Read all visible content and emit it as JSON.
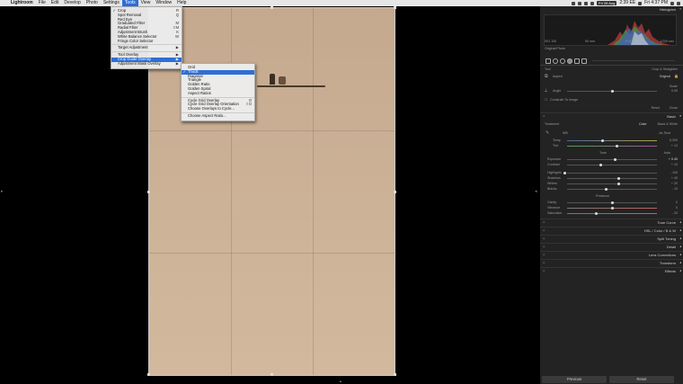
{
  "menubar": {
    "app_name": "Lightroom",
    "items": [
      "File",
      "Edit",
      "Develop",
      "Photo",
      "Settings",
      "Tools",
      "View",
      "Window",
      "Help"
    ],
    "active": "Tools",
    "battery": "Fri 26 Aug",
    "time_left": "2:39 EE",
    "clock": "Fri 4:37 PM"
  },
  "tools_menu": [
    {
      "label": "Crop",
      "key": "R",
      "checked": true
    },
    {
      "label": "Spot Removal",
      "key": "Q"
    },
    {
      "label": "Red Eye",
      "key": ""
    },
    {
      "label": "Graduated Filter",
      "key": "M"
    },
    {
      "label": "Radial Filter",
      "key": "⇧M"
    },
    {
      "label": "Adjustment Brush",
      "key": "K"
    },
    {
      "label": "White Balance Selector",
      "key": "W"
    },
    {
      "label": "Fringe Color Selector",
      "key": ""
    },
    {
      "sep": true
    },
    {
      "label": "Target Adjustment",
      "key": "▶"
    },
    {
      "sep": true
    },
    {
      "label": "Tool Overlay",
      "key": "▶"
    },
    {
      "label": "Crop Guide Overlay",
      "key": "▶",
      "selected": true
    },
    {
      "label": "Adjustment Mask Overlay",
      "key": "▶"
    }
  ],
  "submenu": [
    {
      "label": "Grid"
    },
    {
      "label": "Thirds",
      "checked": true,
      "selected": true
    },
    {
      "label": "Diagonal"
    },
    {
      "label": "Triangle"
    },
    {
      "label": "Golden Ratio"
    },
    {
      "label": "Golden Spiral"
    },
    {
      "label": "Aspect Ratios"
    },
    {
      "sep": true
    },
    {
      "label": "Cycle Grid Overlay",
      "key": "O"
    },
    {
      "label": "Cycle Grid Overlay Orientation",
      "key": "⇧O"
    },
    {
      "label": "Choose Overlays to Cycle..."
    },
    {
      "sep": true
    },
    {
      "label": "Choose Aspect Ratio..."
    }
  ],
  "panel": {
    "histogram_title": "Histogram",
    "hist_left": "ISO 100",
    "hist_mid1": "50 mm",
    "hist_mid2": "f / 5.6",
    "hist_right": "1/200 sec",
    "original_photo": "Original Photo",
    "crop_label": "Tool",
    "crop_right": "Crop & Straighten",
    "aspect_label": "Aspect",
    "aspect_value": "Original",
    "scale_label": "Scale",
    "angle_label": "Angle",
    "angle_value": "0.00",
    "constrain": "Constrain To Image",
    "reset": "Reset",
    "close": "Close",
    "basic_title": "Basic",
    "treatment_label": "Treatment",
    "treatment_color": "Color",
    "treatment_bw": "Black & White",
    "wb_label": "WB",
    "wb_value": "As Shot",
    "temp_label": "Temp",
    "temp_value": "5,200",
    "tint_label": "Tint",
    "tint_value": "+ 12",
    "tone_label": "Tone",
    "auto_label": "Auto",
    "exposure_label": "Exposure",
    "exposure_value": "+ 0.40",
    "contrast_label": "Contrast",
    "contrast_value": "+ 10",
    "highlights_label": "Highlights",
    "highlights_value": "- 100",
    "shadows_label": "Shadows",
    "shadows_value": "+ 40",
    "whites_label": "Whites",
    "whites_value": "+ 20",
    "blacks_label": "Blacks",
    "blacks_value": "- 10",
    "presence_label": "Presence",
    "clarity_label": "Clarity",
    "clarity_value": "0",
    "vibrance_label": "Vibrance",
    "vibrance_value": "0",
    "saturation_label": "Saturation",
    "saturation_value": "- 20",
    "sections": [
      "Tone Curve",
      "HSL / Color / B & W",
      "Split Toning",
      "Detail",
      "Lens Corrections",
      "Transform",
      "Effects"
    ],
    "previous": "Previous",
    "reset_btn": "Reset"
  },
  "colors": {
    "menu_highlight": "#2e6fd6",
    "panel_bg": "#232323",
    "photo_tone": "#c9ae93"
  }
}
